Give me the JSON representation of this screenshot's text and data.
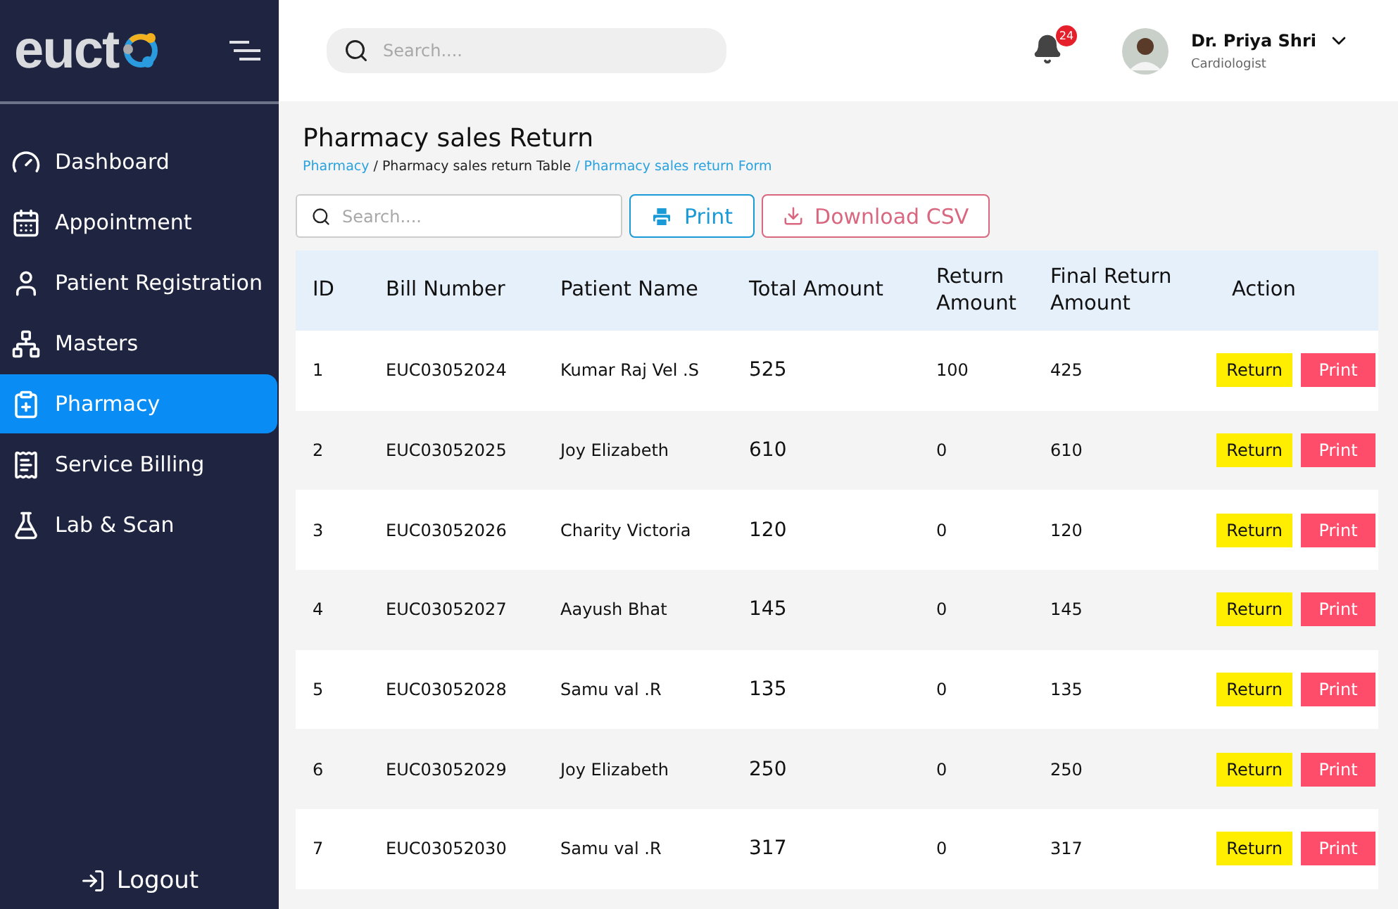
{
  "sidebar": {
    "logo": "euct",
    "items": [
      {
        "label": "Dashboard",
        "selected": false
      },
      {
        "label": "Appointment",
        "selected": false
      },
      {
        "label": "Patient Registration",
        "selected": false
      },
      {
        "label": "Masters",
        "selected": false
      },
      {
        "label": "Pharmacy",
        "selected": true
      },
      {
        "label": "Service Billing",
        "selected": false
      },
      {
        "label": "Lab & Scan",
        "selected": false
      }
    ],
    "logout": "Logout"
  },
  "header": {
    "search": {
      "placeholder": "Search...."
    },
    "notifications": "24",
    "user": {
      "name": "Dr. Priya Shri",
      "role": "Cardiologist"
    }
  },
  "page": {
    "title": "Pharmacy sales Return",
    "breadcrumb": [
      {
        "label": "Pharmacy",
        "kind": "link"
      },
      {
        "label": "/ Pharmacy sales return Table",
        "kind": "current"
      },
      {
        "label": "/ Pharmacy sales return Form",
        "kind": "link"
      }
    ],
    "search": {
      "placeholder": "Search...."
    },
    "print_button": "Print",
    "csv_button": "Download CSV"
  },
  "table": {
    "columns": [
      "ID",
      "Bill Number",
      "Patient Name",
      "Total Amount",
      "Return Amount",
      "Final Return Amount",
      "Action"
    ],
    "rows": [
      {
        "id": "1",
        "bill": "EUC03052024",
        "patient": "Kumar Raj Vel .S",
        "total": "525",
        "return": "100",
        "final": "425",
        "actions": [
          "Return",
          "Print"
        ]
      },
      {
        "id": "2",
        "bill": "EUC03052025",
        "patient": "Joy Elizabeth",
        "total": "610",
        "return": "0",
        "final": "610",
        "actions": [
          "Return",
          "Print"
        ]
      },
      {
        "id": "3",
        "bill": "EUC03052026",
        "patient": "Charity Victoria",
        "total": "120",
        "return": "0",
        "final": "120",
        "actions": [
          "Return",
          "Print"
        ]
      },
      {
        "id": "4",
        "bill": "EUC03052027",
        "patient": "Aayush Bhat",
        "total": "145",
        "return": "0",
        "final": "145",
        "actions": [
          "Return",
          "Print"
        ]
      },
      {
        "id": "5",
        "bill": "EUC03052028",
        "patient": "Samu val .R",
        "total": "135",
        "return": "0",
        "final": "135",
        "actions": [
          "Return",
          "Print"
        ]
      },
      {
        "id": "6",
        "bill": "EUC03052029",
        "patient": "Joy Elizabeth",
        "total": "250",
        "return": "0",
        "final": "250",
        "actions": [
          "Return",
          "Print"
        ]
      },
      {
        "id": "7",
        "bill": "EUC03052030",
        "patient": "Samu val .R",
        "total": "317",
        "return": "0",
        "final": "317",
        "actions": [
          "Return",
          "Print"
        ]
      }
    ]
  }
}
